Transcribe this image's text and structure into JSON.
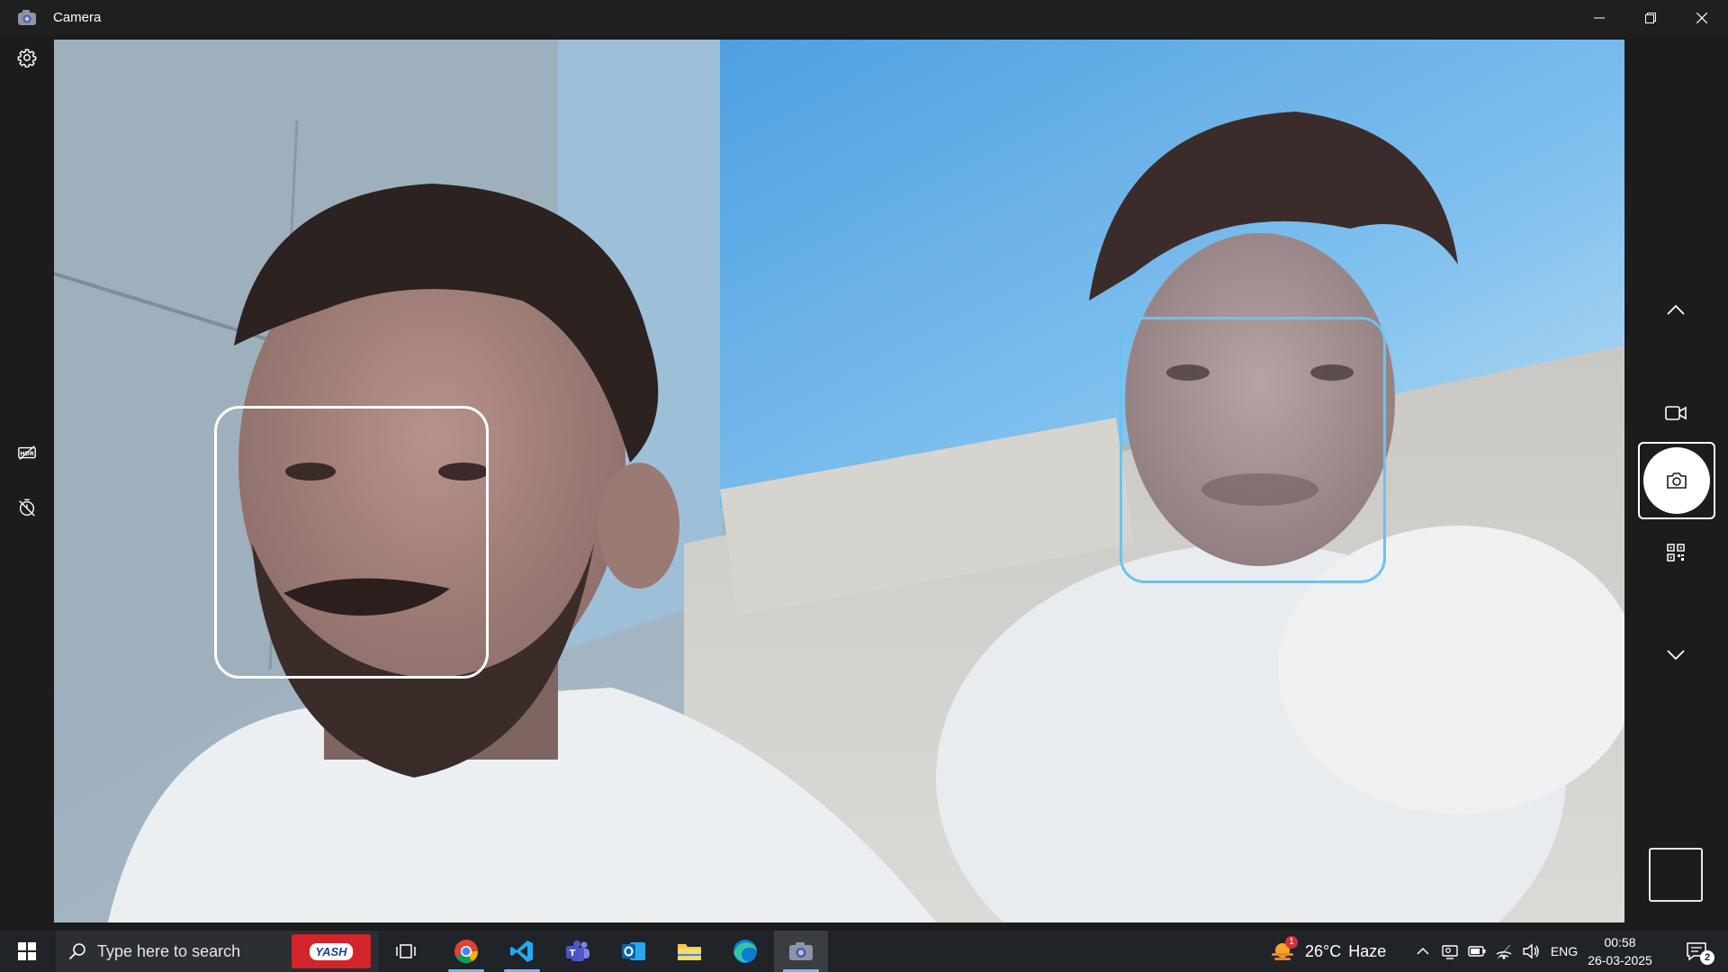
{
  "window": {
    "title": "Camera"
  },
  "left_toolbar": {
    "items": [
      {
        "icon": "gear-icon",
        "label": "Settings"
      },
      {
        "icon": "hdr-off-icon",
        "label": "HDR off"
      },
      {
        "icon": "timer-off-icon",
        "label": "Timer off"
      }
    ]
  },
  "viewfinder": {
    "face_boxes": [
      {
        "color": "#ffffff"
      },
      {
        "color": "#6ac3f0"
      }
    ]
  },
  "right_toolbar": {
    "items": [
      {
        "icon": "chevron-up-icon"
      },
      {
        "icon": "video-mode-icon"
      },
      {
        "icon": "camera-shutter-icon"
      },
      {
        "icon": "qr-scan-icon"
      },
      {
        "icon": "chevron-down-icon"
      }
    ]
  },
  "taskbar": {
    "search_placeholder": "Type here to search",
    "search_promo": "YASH",
    "apps": [
      "chrome-icon",
      "vscode-icon",
      "teams-icon",
      "outlook-icon",
      "file-explorer-icon",
      "edge-icon",
      "camera-app-icon"
    ],
    "weather": {
      "temp": "26°C",
      "condition": "Haze",
      "badge": "1"
    },
    "language": "ENG",
    "time": "00:58",
    "date": "26-03-2025",
    "notifications": "2"
  }
}
